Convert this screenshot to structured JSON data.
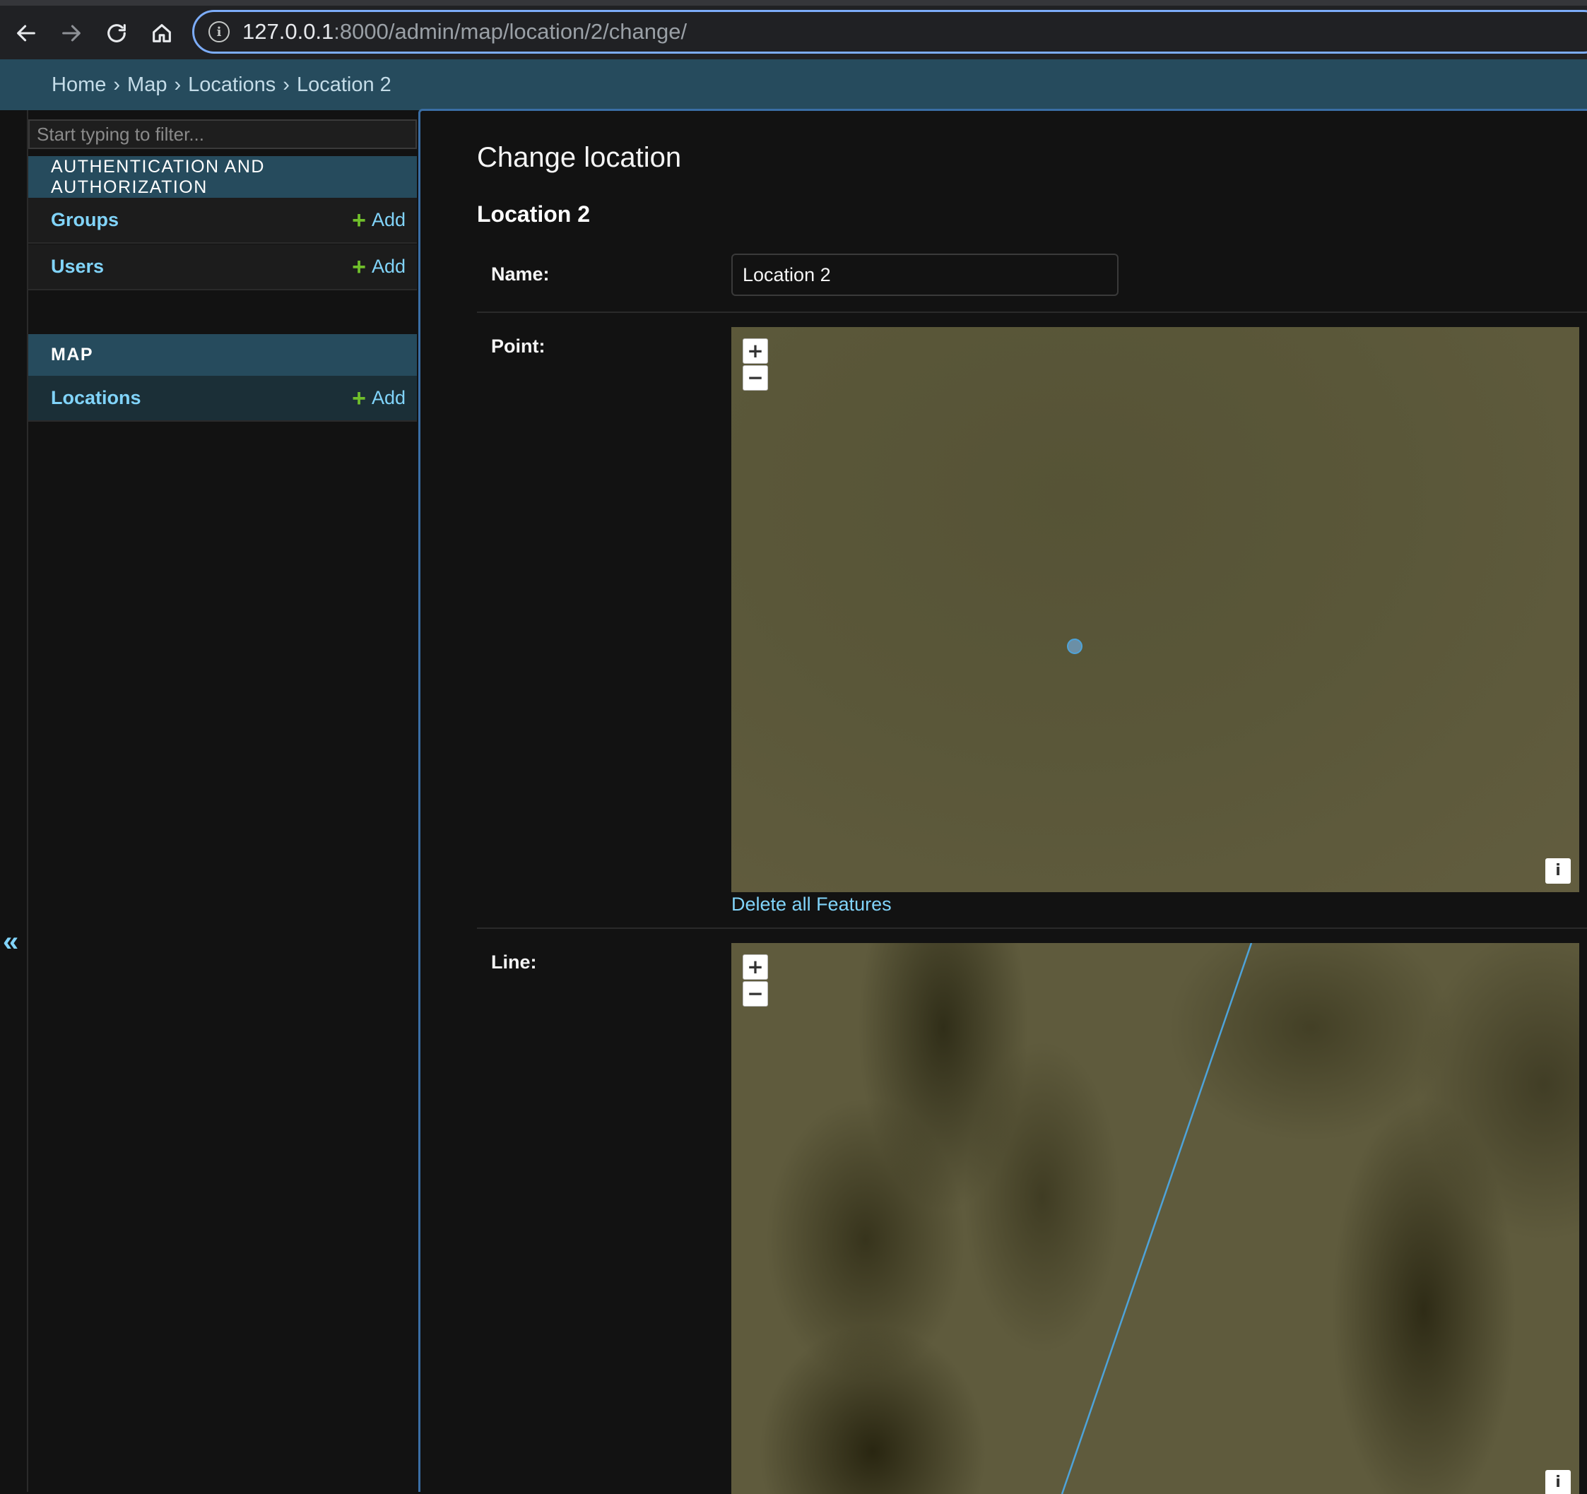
{
  "browser": {
    "url_host": "127.0.0.1",
    "url_path": ":8000/admin/map/location/2/change/"
  },
  "breadcrumbs": [
    {
      "label": "Home"
    },
    {
      "label": "Map"
    },
    {
      "label": "Locations"
    },
    {
      "label": "Location 2"
    }
  ],
  "breadcrumb_separator": "›",
  "sidebar": {
    "filter_placeholder": "Start typing to filter...",
    "apps": [
      {
        "caption": "AUTHENTICATION AND AUTHORIZATION",
        "models": [
          {
            "name": "Groups",
            "add_label": "Add"
          },
          {
            "name": "Users",
            "add_label": "Add"
          }
        ]
      },
      {
        "caption": "MAP",
        "models": [
          {
            "name": "Locations",
            "add_label": "Add"
          }
        ]
      }
    ],
    "collapse_glyph": "«"
  },
  "content": {
    "page_title": "Change location",
    "object_title": "Location 2",
    "fields": {
      "name": {
        "label": "Name:",
        "value": "Location 2"
      },
      "point": {
        "label": "Point:",
        "delete_label": "Delete all Features"
      },
      "line": {
        "label": "Line:"
      }
    },
    "map_controls": {
      "zoom_in": "+",
      "zoom_out": "−",
      "attribution": "i"
    }
  },
  "colors": {
    "header": "#264b5d",
    "link": "#81d4fa",
    "add_plus": "#70bf2b",
    "feature_stroke": "#4ea3d9"
  }
}
